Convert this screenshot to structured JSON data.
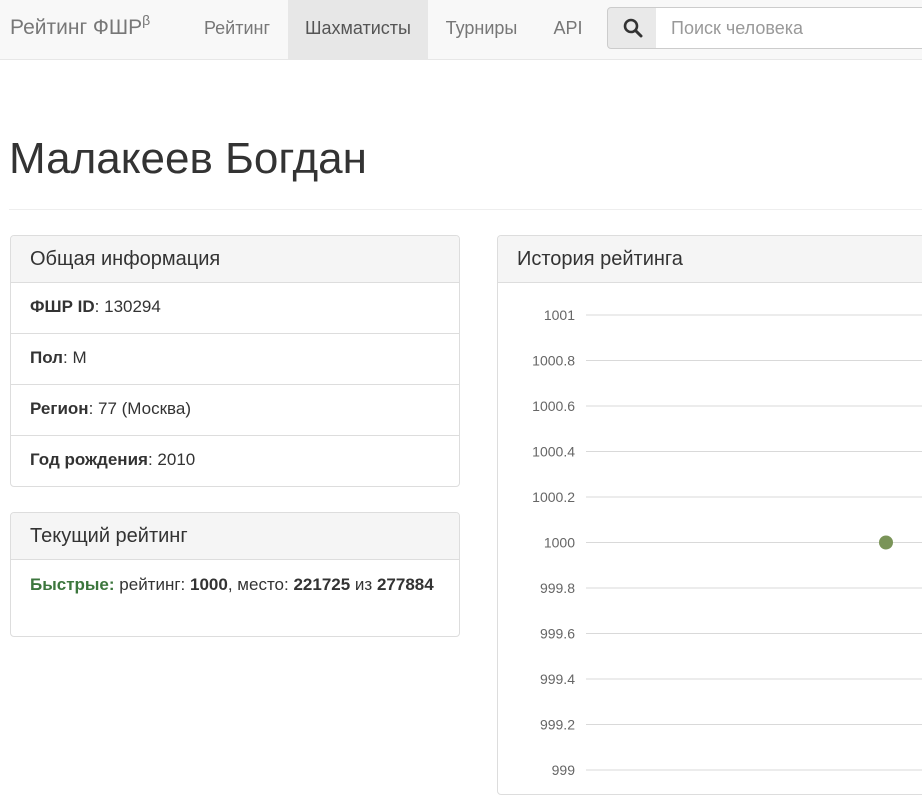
{
  "navbar": {
    "brand": "Рейтинг ФШР",
    "brand_sup": "β",
    "items": [
      {
        "label": "Рейтинг",
        "active": false
      },
      {
        "label": "Шахматисты",
        "active": true
      },
      {
        "label": "Турниры",
        "active": false
      },
      {
        "label": "API",
        "active": false
      }
    ],
    "search_placeholder": "Поиск человека",
    "search_icon": "search-icon"
  },
  "page": {
    "title": "Малакеев Богдан"
  },
  "general_info": {
    "heading": "Общая информация",
    "rows": [
      {
        "label": "ФШР ID",
        "value": "130294"
      },
      {
        "label": "Пол",
        "value": "М"
      },
      {
        "label": "Регион",
        "value": "77 (Москва)"
      },
      {
        "label": "Год рождения",
        "value": "2010"
      }
    ]
  },
  "current_rating": {
    "heading": "Текущий рейтинг",
    "type_label": "Быстрые:",
    "rating_label": "рейтинг:",
    "rating_value": "1000",
    "place_label": "место:",
    "place_value": "221725",
    "of_label": "из",
    "total_value": "277884"
  },
  "history": {
    "heading": "История рейтинга"
  },
  "chart_data": {
    "type": "scatter",
    "title": "",
    "ylim": [
      999,
      1001
    ],
    "yticks": [
      "1001",
      "1000.8",
      "1000.6",
      "1000.4",
      "1000.2",
      "1000",
      "999.8",
      "999.6",
      "999.4",
      "999.2",
      "999"
    ],
    "series": [
      {
        "values": [
          1000
        ],
        "color": "#7a9458"
      }
    ],
    "grid": true
  },
  "colors": {
    "accent_green": "#3c763d",
    "point": "#7a9458"
  }
}
